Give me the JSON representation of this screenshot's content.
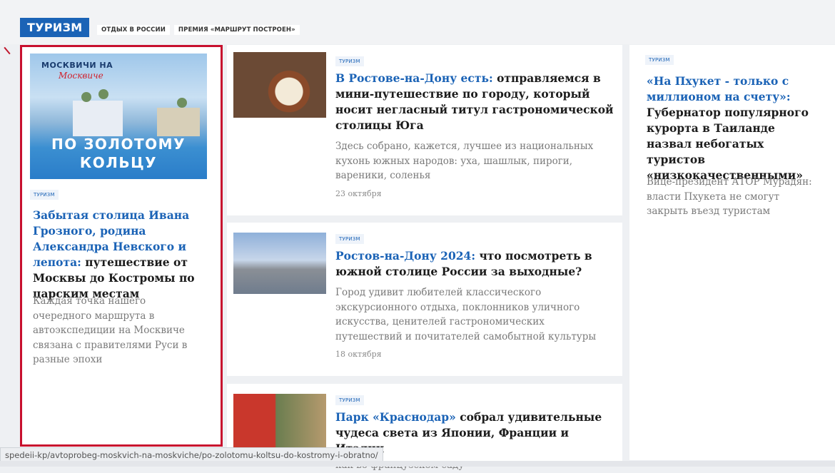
{
  "header": {
    "section_label": "ТУРИЗМ",
    "subnav": [
      "ОТДЫХ В РОССИИ",
      "ПРЕМИЯ «МАРШРУТ ПОСТРОЕН»"
    ]
  },
  "featured": {
    "image_banner_title": "МОСКВИЧИ НА",
    "image_banner_sub": "Москвиче",
    "image_banner_main": "ПО ЗОЛОТОМУ КОЛЬЦУ",
    "tag": "ТУРИЗМ",
    "headline_highlight": "Забытая столица Ивана Грозного, родина Александра Невского и лепота:",
    "headline_rest": " путешествие от Москвы до Костромы по царским местам",
    "lead": "Каждая точка нашего очередного маршрута в автоэкспедиции на Москвиче связана с правителями Руси в разные эпохи"
  },
  "articles": [
    {
      "tag": "ТУРИЗМ",
      "headline_highlight": "В Ростове-на-Дону есть:",
      "headline_rest": " отправляемся в мини-путешествие по городу, который носит негласный титул гастрономической столицы Юга",
      "lead": "Здесь собрано, кажется, лучшее из национальных кухонь южных народов: уха, шашлык, пироги, вареники, соленья",
      "date": "23 октября"
    },
    {
      "tag": "ТУРИЗМ",
      "headline_highlight": "Ростов-на-Дону 2024:",
      "headline_rest": " что посмотреть в южной столице России за выходные?",
      "lead": "Город удивит любителей классического экскурсионного отдыха, поклонников уличного искусства, ценителей гастрономических путешествий и почитателей самобытной культуры",
      "date": "18 октября"
    },
    {
      "tag": "ТУРИЗМ",
      "headline_highlight": "Парк «Краснодар»",
      "headline_rest": " собрал удивительные чудеса света из Японии, Франции и Италии",
      "lead": "как во французском саду"
    }
  ],
  "side": {
    "tag": "ТУРИЗМ",
    "headline_highlight": "«На Пхукет - только с миллионом на счету»:",
    "headline_rest": " Губернатор популярного курорта в Таиланде назвал небогатых туристов «низкокачественными»",
    "lead": "Вице-президент АТОР Мурадян: власти Пхукета не смогут закрыть въезд туристам"
  },
  "status_url": "spedeii-kp/avtoprobeg-moskvich-na-moskviche/po-zolotomu-koltsu-do-kostromy-i-obratno/",
  "colors": {
    "accent": "#1b63b6",
    "highlight_border": "#c8102e"
  }
}
